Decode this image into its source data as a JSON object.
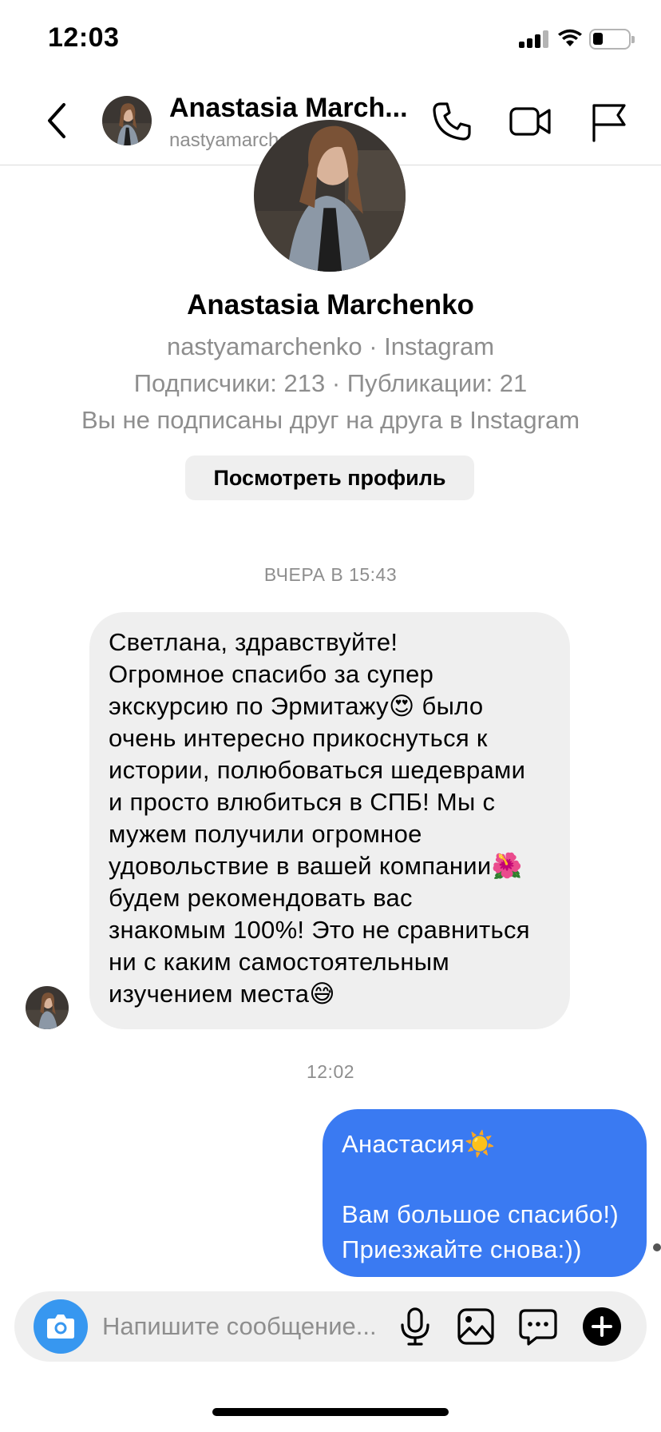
{
  "status_bar": {
    "time": "12:03"
  },
  "header": {
    "name": "Anastasia March...",
    "username": "nastyamarchenko",
    "icons": [
      "back-icon",
      "phone-icon",
      "video-camera-icon",
      "flag-icon"
    ]
  },
  "profile": {
    "name": "Anastasia Marchenko",
    "source": "nastyamarchenko · Instagram",
    "stats": "Подписчики: 213 · Публикации: 21",
    "relation": "Вы не подписаны друг на друга в Instagram",
    "view_profile_label": "Посмотреть профиль"
  },
  "messages": [
    {
      "timestamp": "ВЧЕРА В 15:43",
      "direction": "incoming",
      "text": "Светлана, здравствуйте!\nОгромное спасибо за супер\nэкскурсию по Эрмитажу😍 было\nочень интересно прикоснуться к\nистории, полюбоваться шедеврами\nи просто влюбиться в СПБ! Мы с\nмужем получили огромное\nудовольствие в вашей компании🌺\nбудем рекомендовать вас\nзнакомым 100%! Это не сравниться\nни с каким самостоятельным\nизучением места😅"
    },
    {
      "timestamp": "12:02",
      "direction": "outgoing",
      "text": "Анастасия☀️\n\nВам большое спасибо!)\nПриезжайте снова:))"
    }
  ],
  "composer": {
    "placeholder": "Напишите сообщение...",
    "icons": [
      "camera-icon",
      "microphone-icon",
      "gallery-icon",
      "sticker-chat-icon",
      "plus-icon"
    ]
  },
  "colors": {
    "outgoing_bubble": "#3a7af2",
    "incoming_bubble": "#efefef",
    "camera_button": "#3797f0",
    "secondary_text": "#8e8e8e"
  }
}
